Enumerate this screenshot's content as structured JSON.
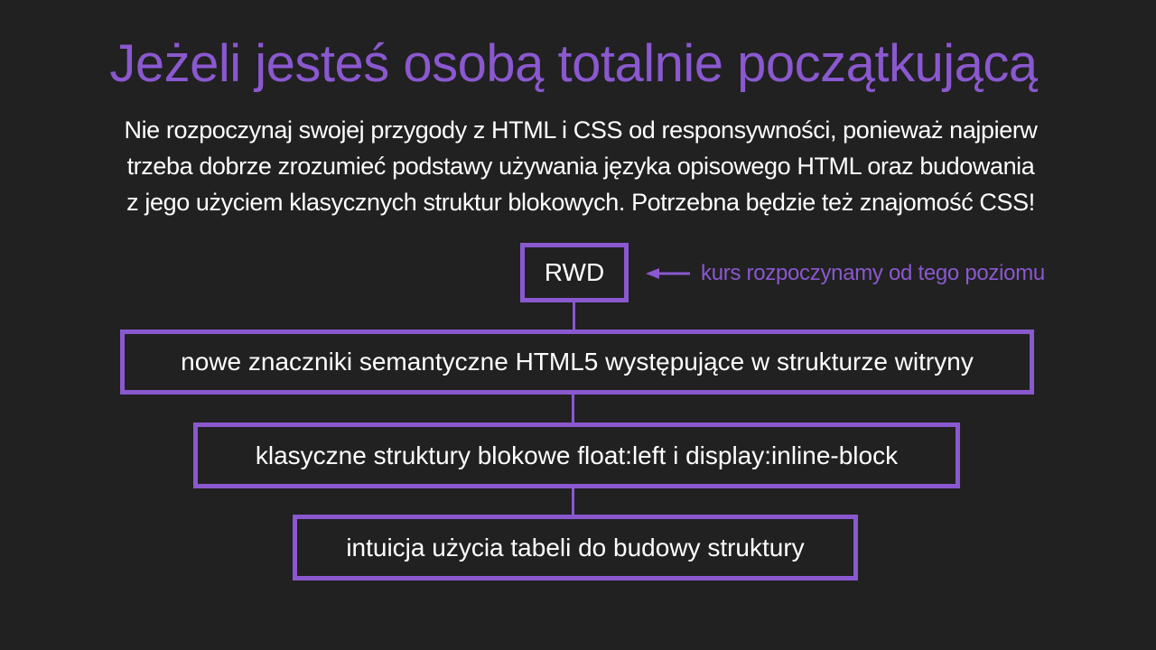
{
  "slide": {
    "title": "Jeżeli jesteś osobą totalnie początkującą",
    "intro_lines": [
      "Nie rozpoczynaj swojej przygody z HTML i CSS od responsywności, ponieważ najpierw",
      "trzeba dobrze zrozumieć podstawy używania języka opisowego HTML oraz budowania",
      "z jego użyciem klasycznych struktur blokowych. Potrzebna będzie też znajomość CSS!"
    ],
    "levels": [
      {
        "label": "RWD"
      },
      {
        "label": "nowe znaczniki semantyczne HTML5 występujące w strukturze witryny"
      },
      {
        "label": "klasyczne struktury blokowe float:left i display:inline-block"
      },
      {
        "label": "intuicja użycia tabeli do budowy struktury"
      }
    ],
    "note": "kurs rozpoczynamy od tego poziomu",
    "accent_color": "#8a58cf",
    "background_color": "#212121",
    "arrow_icon": "arrow-left-icon"
  }
}
